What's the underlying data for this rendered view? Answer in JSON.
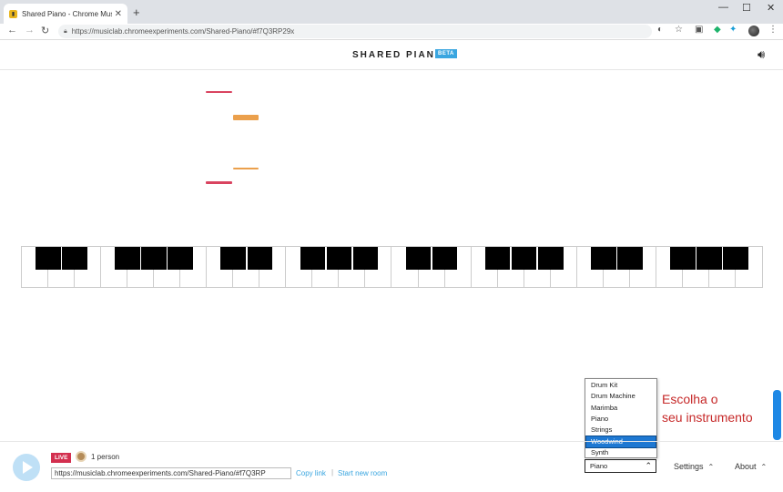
{
  "browser": {
    "tab_title": "Shared Piano - Chrome Music La",
    "url": "https://musiclab.chromeexperiments.com/Shared-Piano/#f7Q3RP29x",
    "new_tab": "+",
    "tab_close": "✕",
    "win_min": "—",
    "win_max": "☐",
    "win_close": "✕"
  },
  "header": {
    "title": "SHARED PIANO",
    "badge": "BETA"
  },
  "notes": [
    {
      "color": "#d9435f"
    },
    {
      "color": "#eba04c"
    },
    {
      "color": "#eba04c"
    },
    {
      "color": "#d9435f"
    }
  ],
  "instruments": {
    "options": [
      "Drum Kit",
      "Drum Machine",
      "Marimba",
      "Piano",
      "Strings",
      "Woodwind",
      "Synth"
    ],
    "highlighted": "Woodwind",
    "selected": "Piano"
  },
  "annotation": {
    "line1": "Escolha o",
    "line2": "seu instrumento"
  },
  "footer": {
    "live_badge": "LIVE",
    "people": "1 person",
    "room_url": "https://musiclab.chromeexperiments.com/Shared-Piano/#f7Q3RP",
    "copy_link": "Copy link",
    "separator": "|",
    "new_room": "Start new room",
    "settings": "Settings",
    "about": "About"
  },
  "colors": {
    "accent": "#3aa6e0",
    "live": "#d32f4f",
    "annotation": "#c62828"
  }
}
